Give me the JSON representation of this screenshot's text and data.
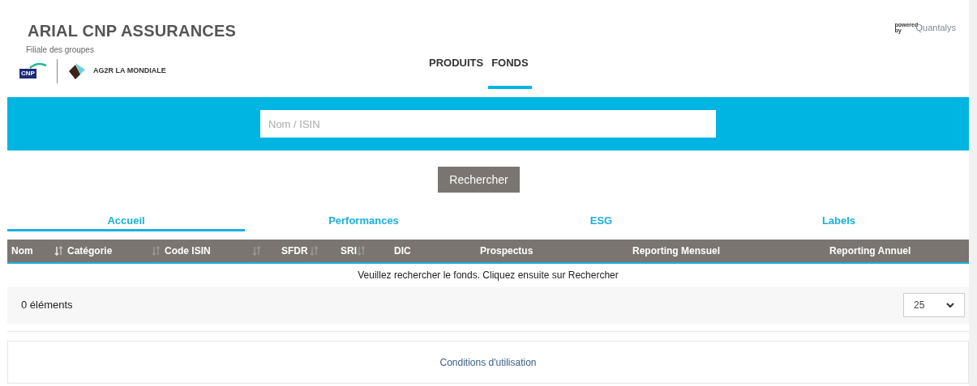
{
  "header": {
    "title": "ARIAL CNP ASSURANCES",
    "subtitle": "Filiale des groupes",
    "logos": [
      "CNP",
      "AG2R LA MONDIALE"
    ],
    "powered_by": "powered by",
    "brand": "Quantalys"
  },
  "nav": [
    {
      "label": "PRODUITS",
      "selected": false
    },
    {
      "label": "FONDS",
      "selected": true
    }
  ],
  "search": {
    "placeholder": "Nom / ISIN",
    "button": "Rechercher"
  },
  "tabs": [
    {
      "label": "Accueil",
      "selected": true
    },
    {
      "label": "Performances",
      "selected": false
    },
    {
      "label": "ESG",
      "selected": false
    },
    {
      "label": "Labels",
      "selected": false
    }
  ],
  "table": {
    "columns": [
      {
        "label": "Nom",
        "kind": "sortable",
        "sorted": true
      },
      {
        "label": "Catégorie",
        "kind": "sortable",
        "sorted": false
      },
      {
        "label": "Code ISIN",
        "kind": "sortable",
        "sorted": false
      },
      {
        "label": "SFDR",
        "kind": "sortable",
        "sorted": false
      },
      {
        "label": "SRI",
        "kind": "sortable",
        "sorted": false
      },
      {
        "label": "DIC",
        "kind": "plain"
      },
      {
        "label": "Prospectus",
        "kind": "plain"
      },
      {
        "label": "Reporting Mensuel",
        "kind": "plain"
      },
      {
        "label": "Reporting Annuel",
        "kind": "plain"
      }
    ],
    "empty_message": "Veuillez rechercher le fonds. Cliquez ensuite sur Rechercher",
    "count": "0 éléments",
    "page_size": "25"
  },
  "footer": {
    "link": "Conditions d'utilisation"
  }
}
